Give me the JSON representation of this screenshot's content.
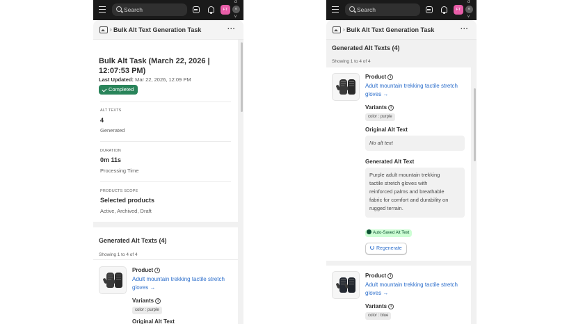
{
  "topbar": {
    "search_placeholder": "Search",
    "avatar_initials": "FT",
    "small_avatar": "e",
    "edge_top": "d",
    "edge_bottom": "v"
  },
  "page": {
    "breadcrumb_sep": "›",
    "title": "Bulk Alt Text Generation Task",
    "menu": "···"
  },
  "task": {
    "heading_line1": "Bulk Alt Task (March 22, 2026 |",
    "heading_line2": "12:07:53 PM)",
    "last_updated_label": "Last Updated:",
    "last_updated_value": " Mar 22, 2026, 12:09 PM",
    "status": "Completed"
  },
  "stats": [
    {
      "label": "ALT TEXTS",
      "value": "4",
      "caption": "Generated"
    },
    {
      "label": "DURATION",
      "value": "0m 11s",
      "caption": "Processing Time"
    },
    {
      "label": "PRODUCTS SCOPE",
      "value": "Selected products",
      "caption": "Active, Archived, Draft"
    }
  ],
  "generated": {
    "title": "Generated Alt Texts (4)",
    "showing": "Showing 1 to 4 of 4"
  },
  "items": [
    {
      "product_label": "Product",
      "product_name_line1": "Adult mountain trekking tactile stretch",
      "product_name_line2": "gloves →",
      "variants_label": "Variants",
      "variant": "color : purple",
      "original_label": "Original Alt Text",
      "original_value": "No alt text",
      "generated_label": "Generated Alt Text",
      "generated_lines": [
        "Purple adult mountain trekking",
        "tactile stretch gloves with",
        "reinforced palms and breathable",
        "fabric for comfort and durability on",
        "rugged terrain."
      ],
      "saved_badge": "Auto-Saved Alt Text",
      "regenerate": "Regenerate"
    },
    {
      "product_label": "Product",
      "product_name_line1": "Adult mountain trekking tactile stretch",
      "product_name_line2": "gloves →",
      "variants_label": "Variants",
      "variant": "color : blue"
    }
  ],
  "colors": {
    "topbar": "#1a1a1a",
    "success": "#29845a",
    "link": "#2c6ecb",
    "avatar": "#e85da8"
  }
}
